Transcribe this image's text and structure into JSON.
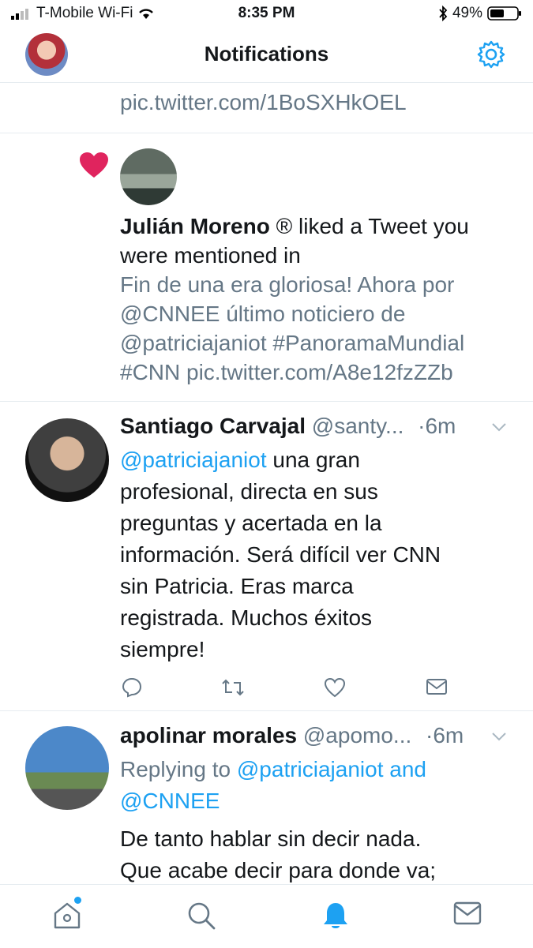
{
  "status_bar": {
    "carrier": "T-Mobile Wi-Fi",
    "time": "8:35 PM",
    "battery": "49%"
  },
  "header": {
    "title": "Notifications"
  },
  "feed": {
    "truncated_top_link": "pic.twitter.com/1BoSXHkOEL",
    "like_notification": {
      "user": "Julián Moreno",
      "badge": "®",
      "action_line1": "liked a Tweet you",
      "action_line2": "were mentioned in",
      "tweet_lines": [
        "Fin de una era gloriosa! Ahora por",
        "@CNNEE último noticiero de",
        "@patriciajaniot #PanoramaMundial",
        "#CNN pic.twitter.com/A8e12fzZZb"
      ]
    },
    "tweets": [
      {
        "name": "Santiago Carvajal",
        "handle": "@santy...",
        "time": "·6m",
        "mention": "@patriciajaniot",
        "text_first": " una gran",
        "lines": [
          "profesional, directa en sus",
          "preguntas y acertada en la",
          "información. Será difícil ver CNN",
          "sin Patricia. Eras marca",
          "registrada. Muchos éxitos",
          "siempre!"
        ]
      },
      {
        "name": "apolinar morales",
        "handle": "@apomo...",
        "time": "·6m",
        "replying_prefix": "Replying to",
        "replying_to": "@patriciajaniot and",
        "replying_to2": "@CNNEE",
        "lines": [
          "De tanto hablar sin decir nada.",
          "Que acabe decir para donde va;"
        ]
      }
    ]
  },
  "colors": {
    "accent": "#1da1f2",
    "like": "#e0245e",
    "muted": "#657786",
    "text": "#14171a"
  }
}
